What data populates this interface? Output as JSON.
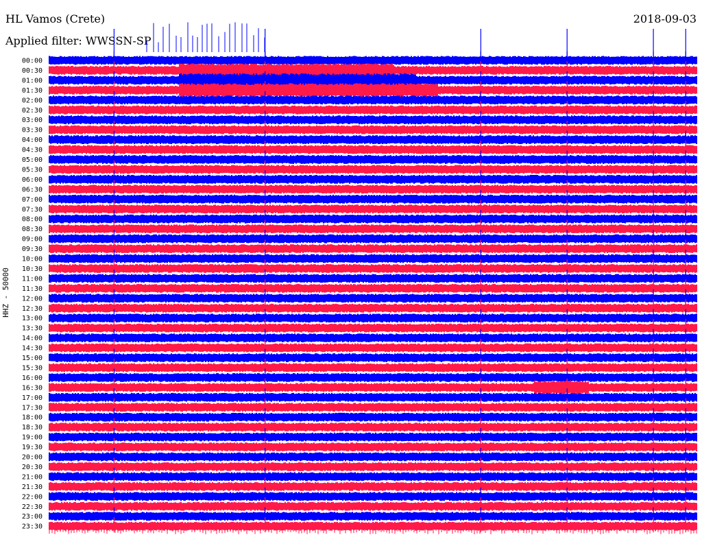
{
  "header": {
    "station": "HL Vamos (Crete)",
    "date": "2018-09-03",
    "filter": "Applied filter: WWSSN-SP",
    "channel_label": "HHZ - 50000"
  },
  "colors": {
    "blue": "#0000ff",
    "red": "#ff1a4a"
  },
  "chart_data": {
    "type": "line",
    "title": "HL Vamos (Crete)",
    "subtitle": "Applied filter: WWSSN-SP",
    "ylabel": "HHZ - 50000",
    "rows": [
      "00:00",
      "00:30",
      "01:00",
      "01:30",
      "02:00",
      "02:30",
      "03:00",
      "03:30",
      "04:00",
      "04:30",
      "05:00",
      "05:30",
      "06:00",
      "06:30",
      "07:00",
      "07:30",
      "08:00",
      "08:30",
      "09:00",
      "09:30",
      "10:00",
      "10:30",
      "11:00",
      "11:30",
      "12:00",
      "12:30",
      "13:00",
      "13:30",
      "14:00",
      "14:30",
      "15:00",
      "15:30",
      "16:00",
      "16:30",
      "17:00",
      "17:30",
      "18:00",
      "18:30",
      "19:00",
      "19:30",
      "20:00",
      "20:30",
      "21:00",
      "21:30",
      "22:00",
      "22:30",
      "23:00",
      "23:30"
    ],
    "row_colors": [
      "blue",
      "red"
    ],
    "events_minutes": [
      3,
      10,
      20,
      24,
      28,
      29.5
    ],
    "noisy_rows": [
      {
        "row": "00:30",
        "from_min": 6,
        "to_min": 16
      },
      {
        "row": "01:00",
        "from_min": 6,
        "to_min": 17
      },
      {
        "row": "01:30",
        "from_min": 6,
        "to_min": 18
      },
      {
        "row": "16:30",
        "from_min": 22.5,
        "to_min": 25
      }
    ],
    "grid": false
  }
}
